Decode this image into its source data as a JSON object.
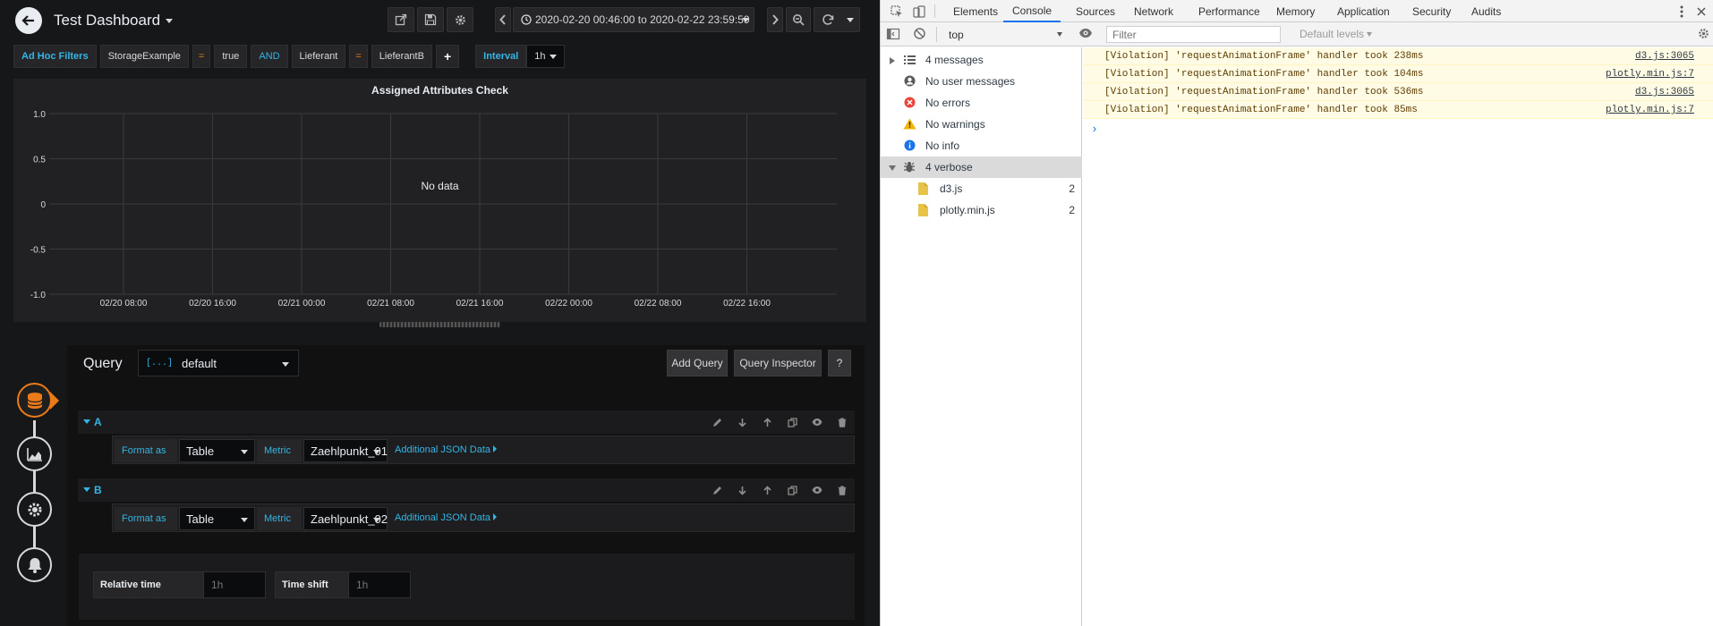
{
  "dashboard": {
    "title": "Test Dashboard",
    "time_range": "2020-02-20 00:46:00 to 2020-02-22 23:59:59"
  },
  "filters": {
    "label": "Ad Hoc Filters",
    "key1": "StorageExample",
    "op1": "=",
    "value1": "true",
    "and_label": "AND",
    "key2": "Lieferant",
    "op2": "=",
    "value2": "LieferantB",
    "plus_label": "+",
    "interval_label": "Interval",
    "interval_value": "1h"
  },
  "panel": {
    "no_data": "No data",
    "chart_data": {
      "type": "line",
      "title": "Assigned Attributes Check",
      "xlabel": "",
      "ylabel": "",
      "x_ticks": [
        "02/20 08:00",
        "02/20 16:00",
        "02/21 00:00",
        "02/21 08:00",
        "02/21 16:00",
        "02/22 00:00",
        "02/22 08:00",
        "02/22 16:00"
      ],
      "y_ticks": [
        "1.0",
        "0.5",
        "0",
        "-0.5",
        "-1.0"
      ],
      "ylim": [
        -1,
        1
      ],
      "grid": true,
      "series": []
    }
  },
  "query_editor": {
    "title": "Query",
    "datasource_icon": "[...]",
    "datasource": "default",
    "add_query": "Add Query",
    "inspector": "Query Inspector",
    "help": "?",
    "queries": [
      {
        "ref": "A",
        "format_label": "Format as",
        "format_value": "Table",
        "metric_label": "Metric",
        "metric_value": "Zaehlpunkt_01",
        "json_link": "Additional JSON Data"
      },
      {
        "ref": "B",
        "format_label": "Format as",
        "format_value": "Table",
        "metric_label": "Metric",
        "metric_value": "Zaehlpunkt_02",
        "json_link": "Additional JSON Data"
      }
    ],
    "relative_time_label": "Relative time",
    "relative_time_placeholder": "1h",
    "time_shift_label": "Time shift",
    "time_shift_placeholder": "1h"
  },
  "devtools": {
    "tabs": [
      "Elements",
      "Console",
      "Sources",
      "Network",
      "Performance",
      "Memory",
      "Application",
      "Security",
      "Audits"
    ],
    "active_tab": "Console",
    "context": "top",
    "filter_placeholder": "Filter",
    "levels": "Default levels",
    "sidebar": [
      {
        "label": "4 messages",
        "count": ""
      },
      {
        "label": "No user messages",
        "count": ""
      },
      {
        "label": "No errors",
        "count": ""
      },
      {
        "label": "No warnings",
        "count": ""
      },
      {
        "label": "No info",
        "count": ""
      },
      {
        "label": "4 verbose",
        "count": ""
      },
      {
        "label": "d3.js",
        "count": "2"
      },
      {
        "label": "plotly.min.js",
        "count": "2"
      }
    ],
    "messages": [
      {
        "text": "[Violation] 'requestAnimationFrame' handler took 238ms",
        "source": "d3.js:3065"
      },
      {
        "text": "[Violation] 'requestAnimationFrame' handler took 104ms",
        "source": "plotly.min.js:7"
      },
      {
        "text": "[Violation] 'requestAnimationFrame' handler took 536ms",
        "source": "d3.js:3065"
      },
      {
        "text": "[Violation] 'requestAnimationFrame' handler took 85ms",
        "source": "plotly.min.js:7"
      }
    ],
    "prompt": "›"
  },
  "colors": {
    "accent_blue": "#33b5e5",
    "accent_orange": "#eb7b18",
    "violation_bg": "#fffbe5"
  }
}
